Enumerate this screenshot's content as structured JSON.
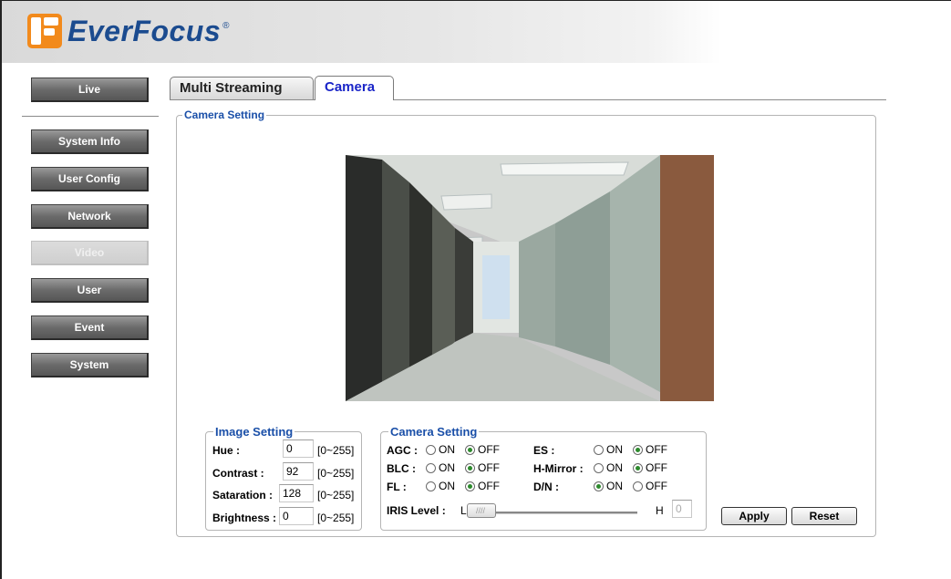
{
  "brand": {
    "name": "EverFocus",
    "reg": "®"
  },
  "nav": {
    "live": "Live",
    "items": [
      {
        "label": "System Info"
      },
      {
        "label": "User Config"
      },
      {
        "label": "Network"
      },
      {
        "label": "Video"
      },
      {
        "label": "User"
      },
      {
        "label": "Event"
      },
      {
        "label": "System"
      }
    ]
  },
  "tabs": [
    {
      "label": "Multi Streaming"
    },
    {
      "label": "Camera"
    }
  ],
  "camera_setting": {
    "title": "Camera Setting"
  },
  "image_setting": {
    "title": "Image Setting",
    "fields": [
      {
        "label": "Hue :",
        "value": "0",
        "range": "[0~255]"
      },
      {
        "label": "Contrast :",
        "value": "92",
        "range": "[0~255]"
      },
      {
        "label": "Sataration :",
        "value": "128",
        "range": "[0~255]"
      },
      {
        "label": "Brightness :",
        "value": "0",
        "range": "[0~255]"
      }
    ]
  },
  "cam_options": {
    "title": "Camera Setting",
    "on": "ON",
    "off": "OFF",
    "rows": [
      {
        "label": "AGC :",
        "selected": "OFF"
      },
      {
        "label": "BLC :",
        "selected": "OFF"
      },
      {
        "label": "FL :",
        "selected": "OFF"
      },
      {
        "label": "ES :",
        "selected": "OFF"
      },
      {
        "label": "H-Mirror :",
        "selected": "OFF"
      },
      {
        "label": "D/N :",
        "selected": "ON"
      }
    ],
    "iris": {
      "label": "IRIS Level :",
      "low": "L",
      "high": "H",
      "value": "0"
    }
  },
  "buttons": {
    "apply": "Apply",
    "reset": "Reset"
  },
  "colors": {
    "accent": "#1a4fa8",
    "tab_active": "#1a25c8",
    "radio_on": "#2d8a2d"
  }
}
